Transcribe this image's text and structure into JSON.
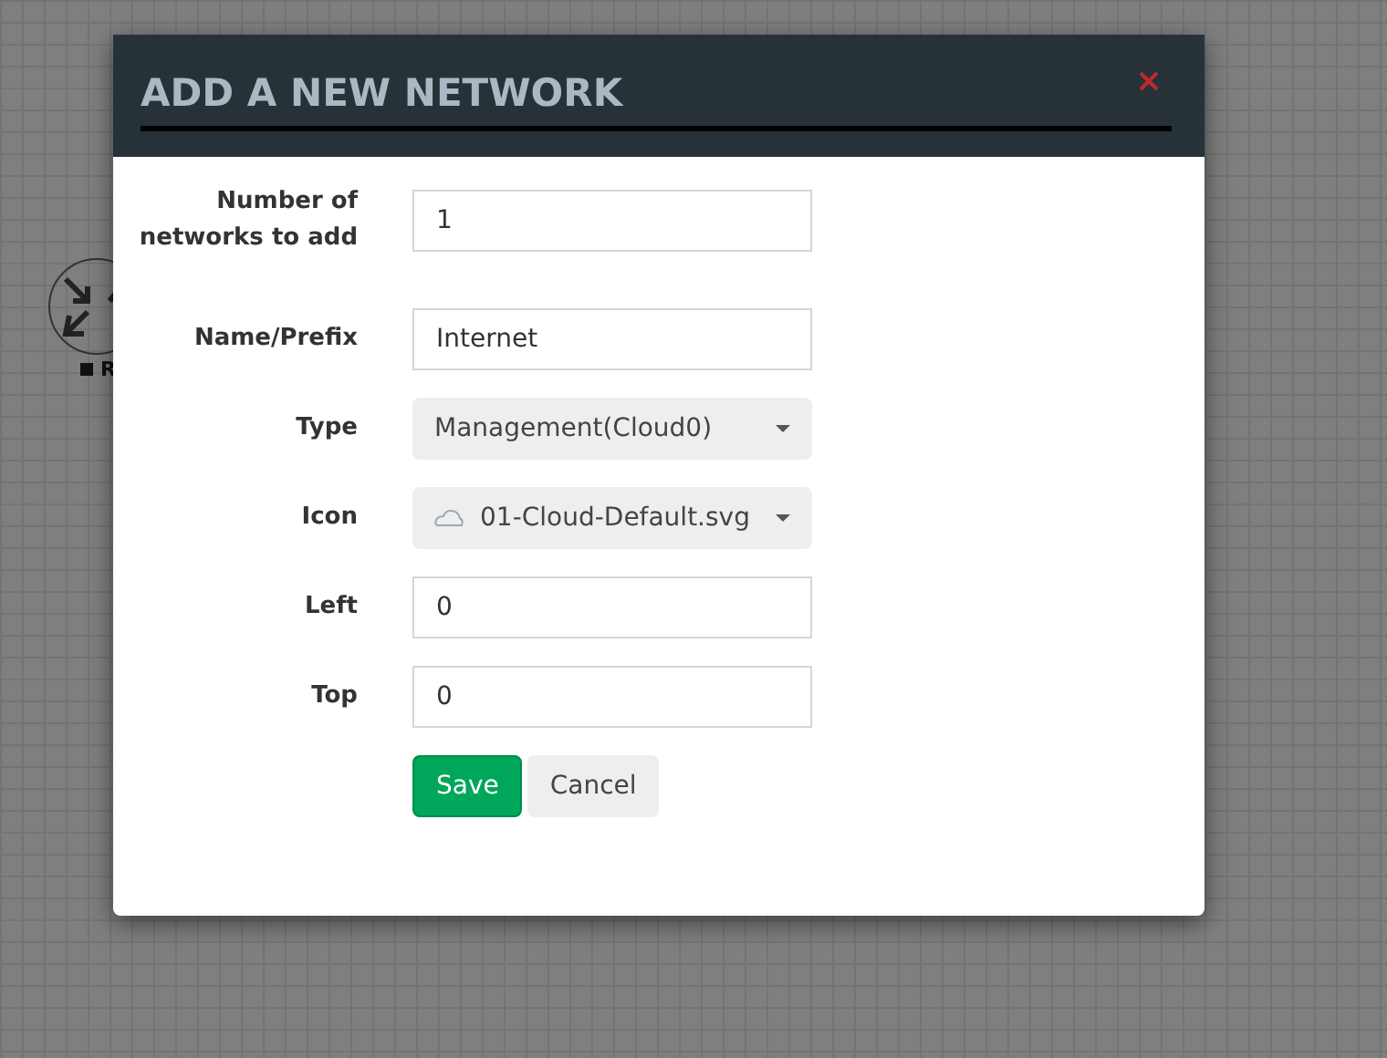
{
  "background_node": {
    "label": "R"
  },
  "dialog": {
    "title": "ADD A NEW NETWORK",
    "fields": [
      {
        "kind": "text",
        "label": "Number of networks to add",
        "value": "1"
      },
      {
        "kind": "text",
        "label": "Name/Prefix",
        "value": "Internet"
      },
      {
        "kind": "select",
        "label": "Type",
        "value": "Management(Cloud0)"
      },
      {
        "kind": "select",
        "label": "Icon",
        "value": "01-Cloud-Default.svg",
        "has_icon": true
      },
      {
        "kind": "text",
        "label": "Left",
        "value": "0"
      },
      {
        "kind": "text",
        "label": "Top",
        "value": "0"
      }
    ],
    "buttons": [
      {
        "label": "Save",
        "kind": "primary"
      },
      {
        "label": "Cancel",
        "kind": "default"
      }
    ]
  }
}
